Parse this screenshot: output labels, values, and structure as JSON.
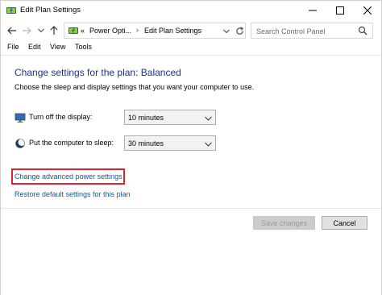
{
  "window": {
    "title": "Edit Plan Settings"
  },
  "nav": {
    "breadcrumb_prefix": "«",
    "crumbs": [
      "Power Opti...",
      "Edit Plan Settings"
    ]
  },
  "search": {
    "placeholder": "Search Control Panel"
  },
  "menu": [
    "File",
    "Edit",
    "View",
    "Tools"
  ],
  "main": {
    "heading": "Change settings for the plan: Balanced",
    "subheading": "Choose the sleep and display settings that you want your computer to use.",
    "settings": [
      {
        "label": "Turn off the display:",
        "value": "10 minutes",
        "icon": "monitor-icon"
      },
      {
        "label": "Put the computer to sleep:",
        "value": "30 minutes",
        "icon": "moon-icon"
      }
    ],
    "links": {
      "advanced": "Change advanced power settings",
      "restore": "Restore default settings for this plan"
    }
  },
  "footer": {
    "save_label": "Save changes",
    "cancel_label": "Cancel"
  },
  "colors": {
    "heading": "#1e3287",
    "link": "#0a5ab4",
    "highlight": "#e0202a"
  }
}
